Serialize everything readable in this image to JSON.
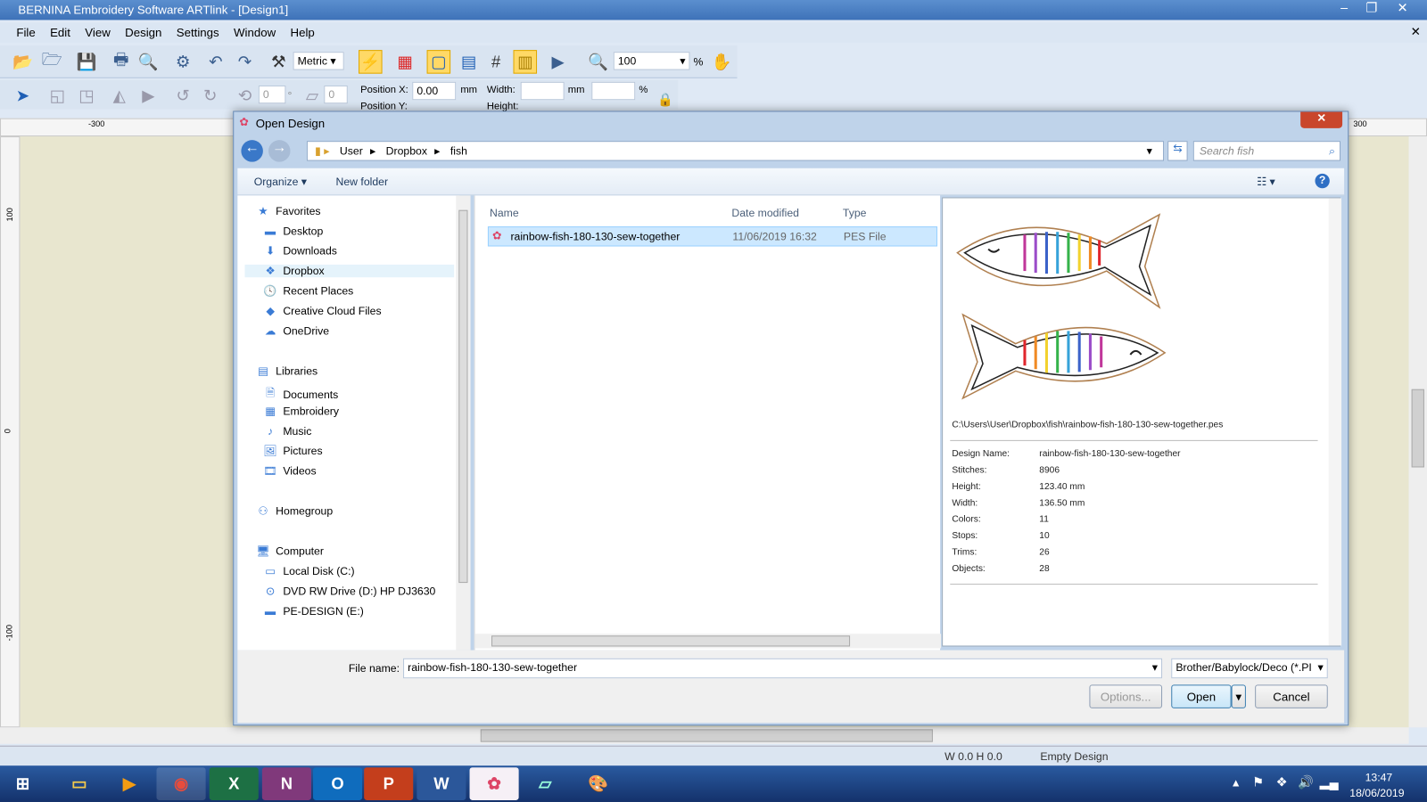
{
  "app": {
    "title": "BERNINA Embroidery Software ARTlink - [Design1]"
  },
  "menu": [
    "File",
    "Edit",
    "View",
    "Design",
    "Settings",
    "Window",
    "Help"
  ],
  "toolbar": {
    "units": "Metric",
    "zoom": "100",
    "zoom_unit": "%"
  },
  "toolbar2": {
    "rotate_value": "0",
    "deg": "°",
    "skew_value": "0",
    "pos_x_label": "Position X:",
    "pos_x": "0.00",
    "pos_y_label": "Position Y:",
    "mm": "mm",
    "width_label": "Width:",
    "height_label": "Height:",
    "pct": "%"
  },
  "ruler": {
    "top": [
      "-300",
      "300"
    ],
    "left": [
      "100",
      "0",
      "-100"
    ]
  },
  "dialog": {
    "title": "Open Design",
    "breadcrumb": [
      "User",
      "Dropbox",
      "fish"
    ],
    "search_placeholder": "Search fish",
    "organize": "Organize ▾",
    "new_folder": "New folder",
    "nav": {
      "favorites": "Favorites",
      "fav_items": [
        "Desktop",
        "Downloads",
        "Dropbox",
        "Recent Places",
        "Creative Cloud Files",
        "OneDrive"
      ],
      "libraries": "Libraries",
      "lib_items": [
        "Documents",
        "Embroidery",
        "Music",
        "Pictures",
        "Videos"
      ],
      "homegroup": "Homegroup",
      "computer": "Computer",
      "comp_items": [
        "Local Disk (C:)",
        "DVD RW Drive (D:) HP DJ3630",
        "PE-DESIGN (E:)"
      ]
    },
    "columns": {
      "name": "Name",
      "date": "Date modified",
      "type": "Type"
    },
    "files": [
      {
        "name": "rainbow-fish-180-130-sew-together",
        "date": "11/06/2019 16:32",
        "type": "PES File"
      }
    ],
    "preview": {
      "path": "C:\\Users\\User\\Dropbox\\fish\\rainbow-fish-180-130-sew-together.pes",
      "props": [
        [
          "Design Name:",
          "rainbow-fish-180-130-sew-together"
        ],
        [
          "Stitches:",
          "8906"
        ],
        [
          "Height:",
          "123.40 mm"
        ],
        [
          "Width:",
          "136.50 mm"
        ],
        [
          "Colors:",
          "11"
        ],
        [
          "Stops:",
          "10"
        ],
        [
          "Trims:",
          "26"
        ],
        [
          "Objects:",
          "28"
        ]
      ]
    },
    "filename_label": "File name:",
    "filename": "rainbow-fish-180-130-sew-together",
    "filetype": "Brother/Babylock/Deco (*.PI",
    "options": "Options...",
    "open": "Open",
    "cancel": "Cancel"
  },
  "status": {
    "wh": "W   0.0 H   0.0",
    "design": "Empty Design"
  },
  "taskbar": {
    "time": "13:47",
    "date": "18/06/2019"
  }
}
